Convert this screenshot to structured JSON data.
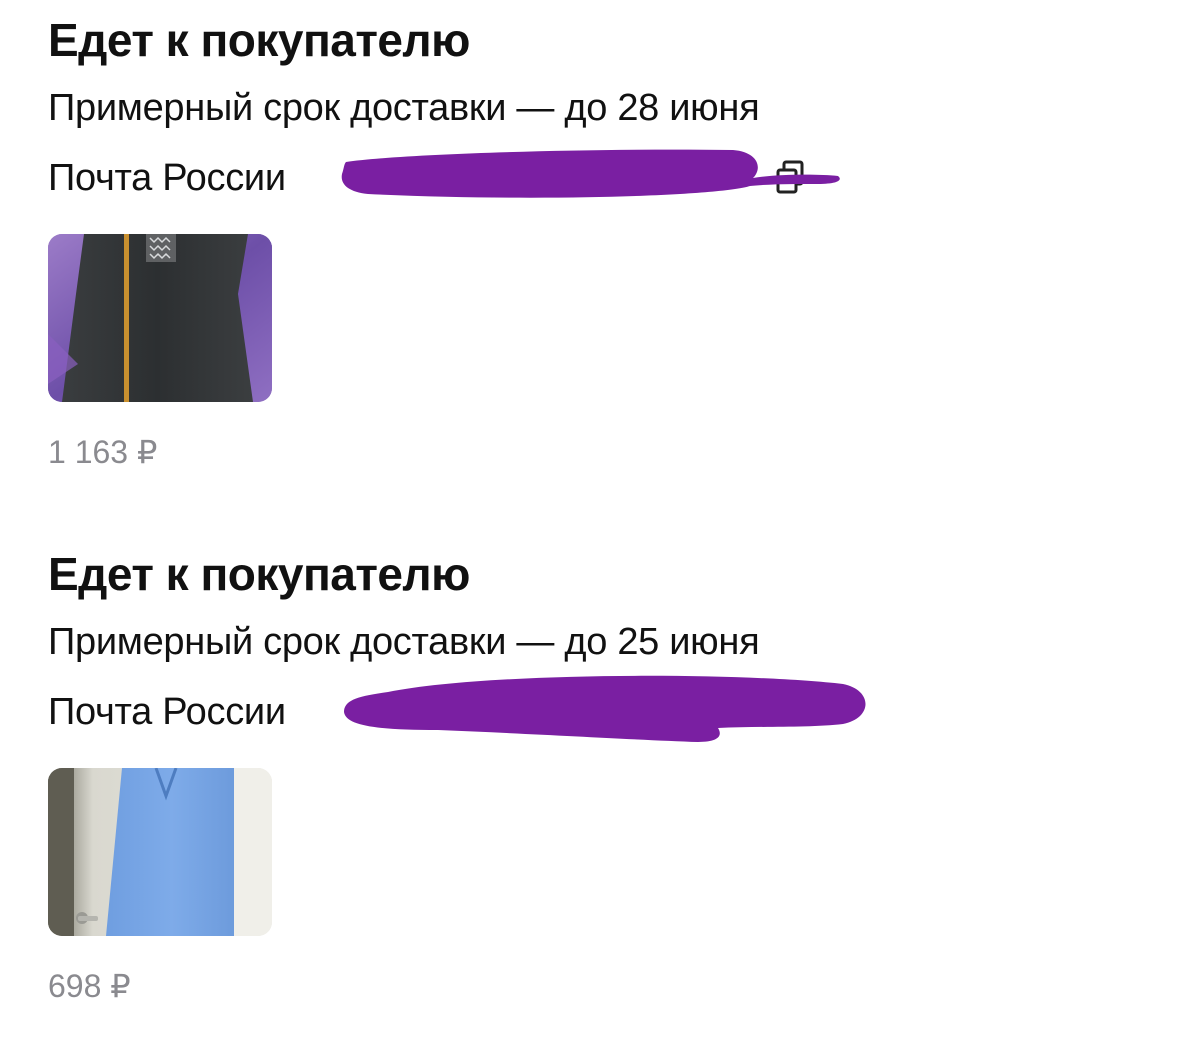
{
  "orders": [
    {
      "status": "Едет к покупателю",
      "eta": "Примерный срок доставки — до 28 июня",
      "carrier": "Почта России",
      "tracking_redacted": true,
      "copy_icon": "copy-icon",
      "item_image": "black-dress-photo",
      "price": "1 163 ₽"
    },
    {
      "status": "Едет к покупателю",
      "eta": "Примерный срок доставки — до 25 июня",
      "carrier": "Почта России",
      "tracking_redacted": true,
      "item_image": "blue-dress-photo",
      "price": "698 ₽"
    }
  ],
  "colors": {
    "redaction": "#7a1fa2",
    "price": "#8a8a8f",
    "text": "#111111"
  }
}
